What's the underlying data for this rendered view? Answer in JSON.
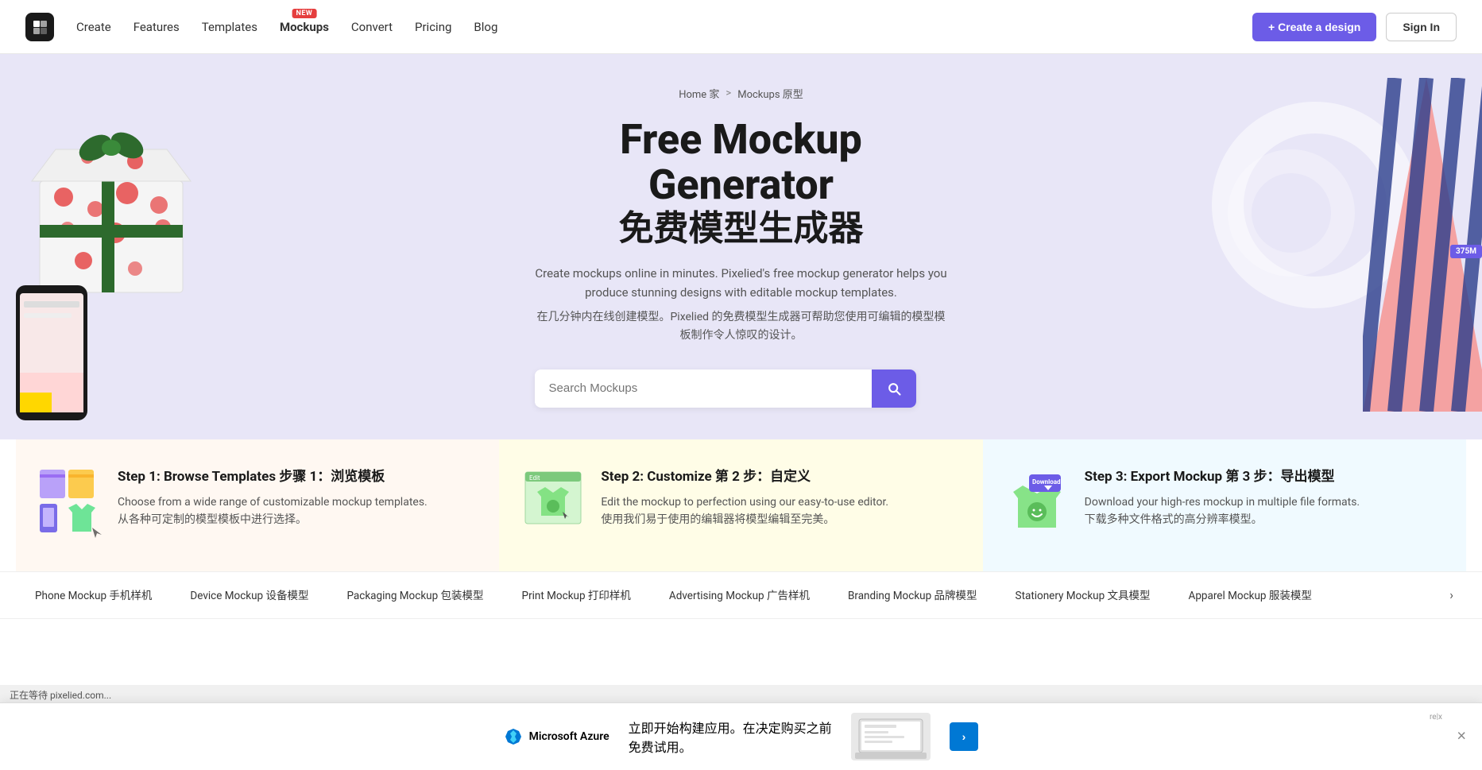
{
  "navbar": {
    "logo_symbol": "▶",
    "links": [
      {
        "label": "Create",
        "name": "create",
        "active": false
      },
      {
        "label": "Features",
        "name": "features",
        "active": false
      },
      {
        "label": "Templates",
        "name": "templates",
        "active": false
      },
      {
        "label": "Mockups",
        "name": "mockups",
        "active": true,
        "badge": "NEW"
      },
      {
        "label": "Convert",
        "name": "convert",
        "active": false
      },
      {
        "label": "Pricing",
        "name": "pricing",
        "active": false
      },
      {
        "label": "Blog",
        "name": "blog",
        "active": false
      }
    ],
    "create_btn": "+ Create a design",
    "signin_btn": "Sign In"
  },
  "hero": {
    "breadcrumb_home": "Home 家",
    "breadcrumb_sep": ">",
    "breadcrumb_current": "Mockups 原型",
    "title_en": "Free Mockup Generator",
    "title_cn": "免费模型生成器",
    "desc_en": "Create mockups online in minutes. Pixelied's free mockup generator helps you produce stunning designs with editable mockup templates.",
    "desc_cn": "在几分钟内在线创建模型。Pixelied 的免费模型生成器可帮助您使用可编辑的模型模板制作令人惊叹的设计。",
    "search_placeholder": "Search Mockups",
    "counter": "375M"
  },
  "steps": [
    {
      "title": "Step 1: Browse Templates 步骤 1：浏览模板",
      "desc_en": "Choose from a wide range of customizable mockup templates.",
      "desc_cn": "从各种可定制的模型模板中进行选择。",
      "icon": "🖼️"
    },
    {
      "title": "Step 2: Customize 第 2 步：自定义",
      "desc_en": "Edit the mockup to perfection using our easy-to-use editor.",
      "desc_cn": "使用我们易于使用的编辑器将模型编辑至完美。",
      "icon": "✏️"
    },
    {
      "title": "Step 3: Export Mockup 第 3 步：导出模型",
      "desc_en": "Download your high-res mockup in multiple file formats.",
      "desc_cn": "下载多种文件格式的高分辨率模型。",
      "icon": "⬇️"
    }
  ],
  "categories": [
    "Phone Mockup 手机样机",
    "Device Mockup 设备模型",
    "Packaging Mockup 包装模型",
    "Print Mockup 打印样机",
    "Advertising Mockup 广告样机",
    "Branding Mockup 品牌模型",
    "Stationery Mockup 文具模型",
    "Apparel Mockup 服装模型"
  ],
  "ad_banner": {
    "logo_text": "Microsoft Azure",
    "text_line1": "立即开始构建应用。在决定购买之前",
    "text_line2": "免费试用。",
    "cta_label": "›",
    "tag_text": "re|x",
    "close_label": "×"
  },
  "status_bar": {
    "text": "正在等待 pixelied.com..."
  }
}
